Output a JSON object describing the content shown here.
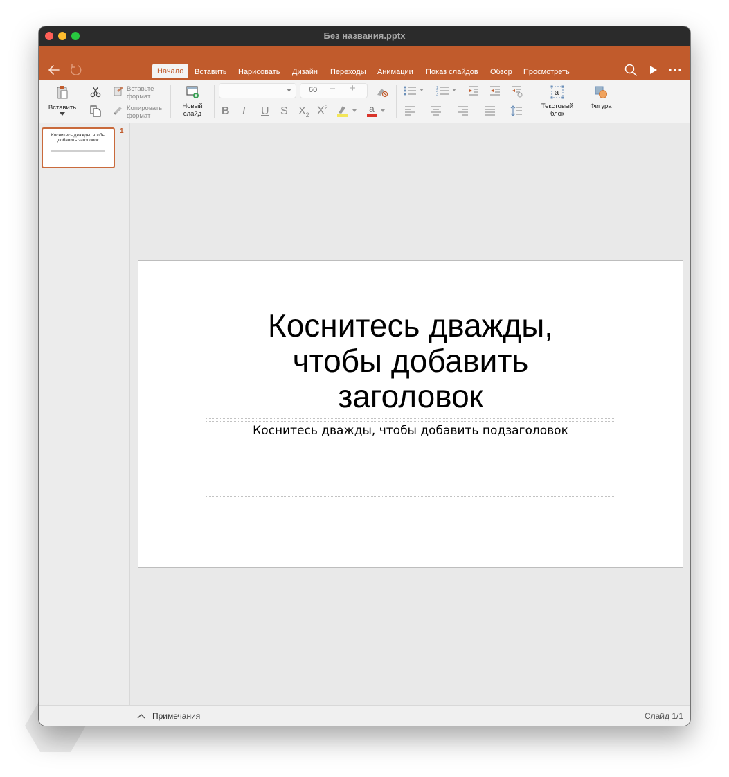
{
  "window": {
    "title": "Без названия.pptx"
  },
  "tabs": [
    {
      "label": "Начало",
      "active": true
    },
    {
      "label": "Вставить"
    },
    {
      "label": "Нарисовать"
    },
    {
      "label": "Дизайн"
    },
    {
      "label": "Переходы"
    },
    {
      "label": "Анимации"
    },
    {
      "label": "Показ слайдов"
    },
    {
      "label": "Обзор"
    },
    {
      "label": "Просмотреть"
    }
  ],
  "ribbon": {
    "paste_label": "Вставить",
    "paste_format_line1": "Вставьте",
    "paste_format_line2": "формат",
    "copy_format_line1": "Копировать",
    "copy_format_line2": "формат",
    "new_slide_line1": "Новый",
    "new_slide_line2": "слайд",
    "font_name": "",
    "font_size": "60",
    "textbox_line1": "Текстовый",
    "textbox_line2": "блок",
    "shape_label": "Фигура"
  },
  "thumbnail": {
    "number": "1",
    "title": "Коснитесь дважды, чтобы добавить заголовок"
  },
  "slide": {
    "title_line1": "Коснитесь дважды,",
    "title_line2": "чтобы добавить",
    "title_line3": "заголовок",
    "subtitle": "Коснитесь дважды, чтобы добавить подзаголовок"
  },
  "status": {
    "notes_label": "Примечания",
    "slide_counter": "Слайд 1/1"
  },
  "colors": {
    "accent": "#c15b2c",
    "titlebar": "#2b2b2b"
  },
  "icons": [
    "back-arrow-icon",
    "redo-icon",
    "search-icon",
    "play-icon",
    "more-icon",
    "paste-icon",
    "cut-icon",
    "copy-icon",
    "format-painter-icon",
    "new-slide-icon",
    "clear-format-icon",
    "bullets-icon",
    "numbering-icon",
    "increase-indent-icon",
    "decrease-indent-icon",
    "text-direction-icon",
    "textbox-icon",
    "shape-icon",
    "add-slide-icon",
    "chevron-up-icon"
  ]
}
